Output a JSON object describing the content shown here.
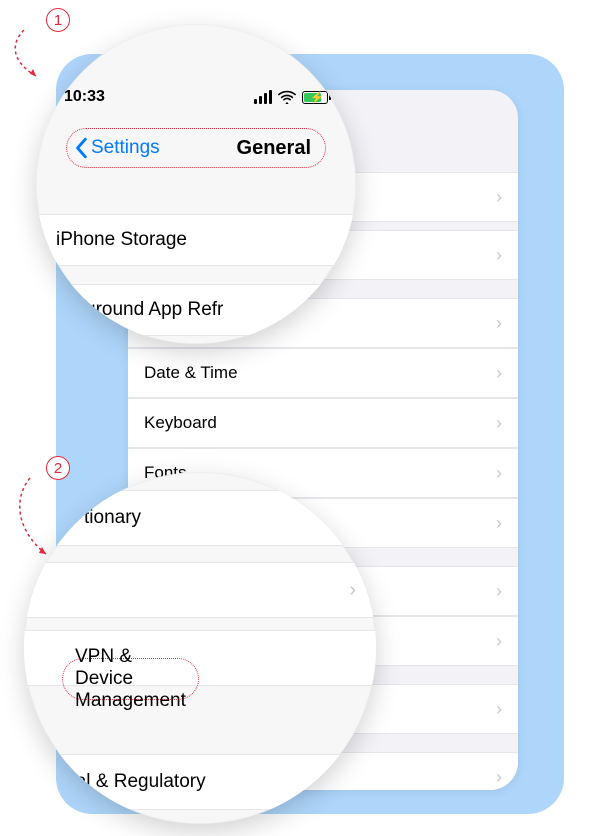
{
  "status": {
    "time": "10:33"
  },
  "nav": {
    "back_label": "Settings",
    "title": "General"
  },
  "mag1": {
    "row1": "iPhone Storage",
    "row2_partial_prefix": "ckground App Refr"
  },
  "bg_rows": {
    "r1": "Date & Time",
    "r2": "Keyboard",
    "r3": "Fonts"
  },
  "mag2": {
    "r1_partial": "tionary",
    "r3": "VPN & Device Management",
    "r4": "Legal & Regulatory"
  },
  "callouts": {
    "c1": "1",
    "c2": "2"
  }
}
